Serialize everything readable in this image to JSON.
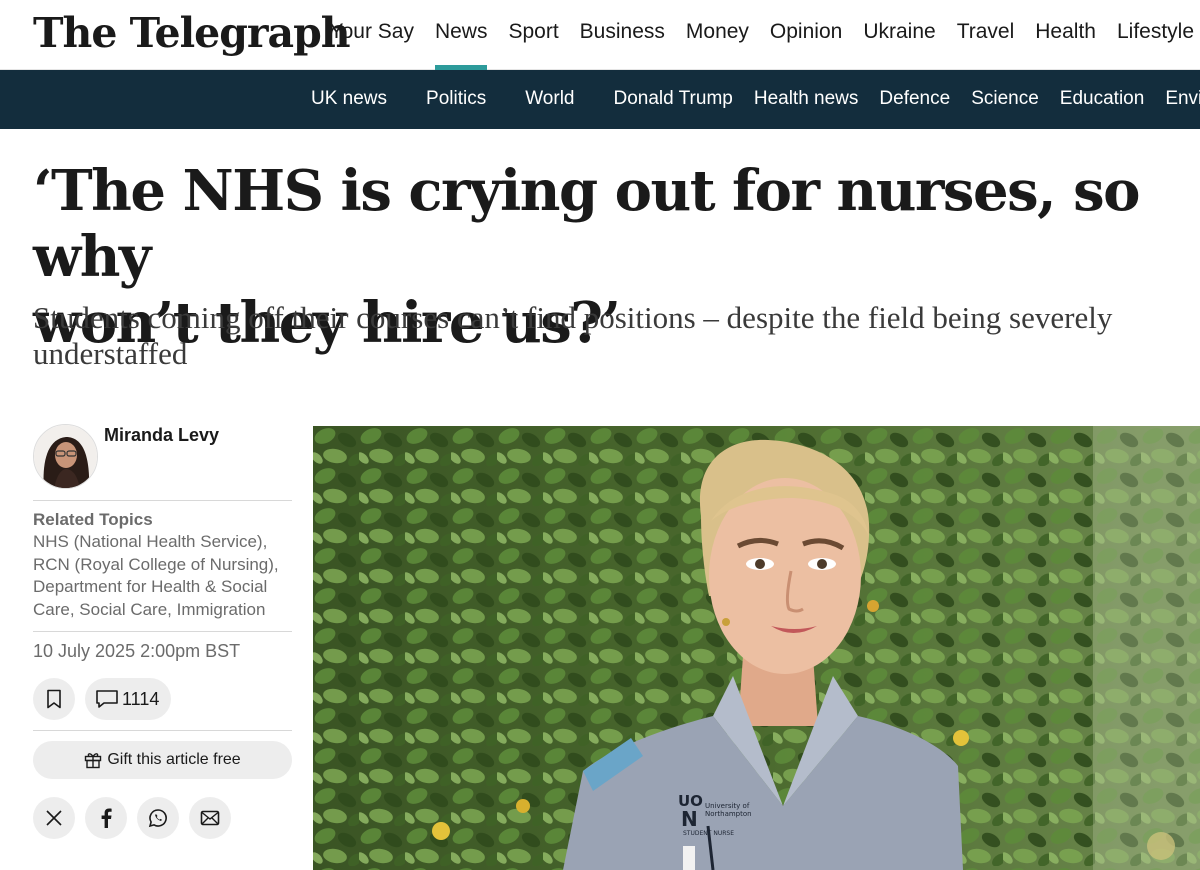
{
  "header": {
    "logo_text": "The Telegraph",
    "nav": [
      "Your Say",
      "News",
      "Sport",
      "Business",
      "Money",
      "Opinion",
      "Ukraine",
      "Travel",
      "Health",
      "Lifestyle"
    ],
    "active_nav": "News"
  },
  "subnav": [
    "UK news",
    "Politics",
    "World",
    "Donald Trump",
    "Health news",
    "Defence",
    "Science",
    "Education",
    "Enviro"
  ],
  "article": {
    "headline_line1": "‘The NHS is crying out for nurses, so why",
    "headline_line2": "won’t they hire us?’",
    "standfirst": "Students coming off their courses can’t find positions – despite the field being severely understaffed",
    "author": "Miranda Levy",
    "related_title": "Related Topics",
    "related_topics": "NHS (National Health Service), RCN (Royal College of Nursing), Department for Health & Social Care, Social Care, Immigration",
    "date": "10 July 2025 2:00pm BST",
    "comment_count": "1114",
    "gift_label": "Gift this article free"
  },
  "hero_badge": {
    "line1": "UO",
    "line2": "N",
    "text1": "University of",
    "text2": "Northampton",
    "text3": "STUDENT NURSE"
  },
  "colors": {
    "accent": "#2d9b9b",
    "subnav_bg": "#132d3d",
    "button_bg": "#ededed",
    "muted_text": "#6b6b6b"
  },
  "icons": [
    "bookmark-icon",
    "comment-icon",
    "gift-icon",
    "x-icon",
    "facebook-icon",
    "whatsapp-icon",
    "email-icon"
  ]
}
